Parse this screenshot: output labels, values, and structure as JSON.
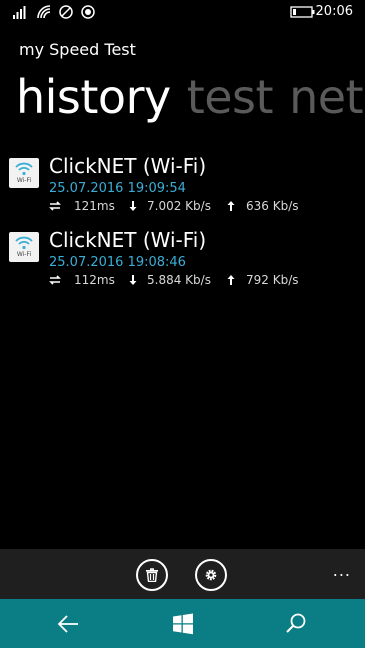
{
  "status": {
    "time": "20:06",
    "icons": [
      "signal-icon",
      "wifi-icon",
      "vibrate-icon",
      "location-icon",
      "battery-icon"
    ]
  },
  "app": {
    "title": "my Speed Test"
  },
  "pivot": {
    "tabs": [
      {
        "label": "history",
        "active": true
      },
      {
        "label": "test",
        "active": false
      },
      {
        "label": "net",
        "active": false
      }
    ]
  },
  "history": [
    {
      "tile_label": "Wi-Fi",
      "name": "ClickNET (Wi-Fi)",
      "date": "25.07.2016 19:09:54",
      "ping": "121ms",
      "download": "7.002 Kb/s",
      "upload": "636 Kb/s"
    },
    {
      "tile_label": "Wi-Fi",
      "name": "ClickNET (Wi-Fi)",
      "date": "25.07.2016 19:08:46",
      "ping": "112ms",
      "download": "5.884 Kb/s",
      "upload": "792 Kb/s"
    }
  ],
  "appbar": {
    "buttons": [
      "delete-icon",
      "settings-icon"
    ],
    "more": "..."
  },
  "navbar": {
    "buttons": [
      "back-icon",
      "windows-icon",
      "search-icon"
    ]
  },
  "colors": {
    "accent": "#3aaed6",
    "nav_bar": "#0b7d84",
    "app_bar": "#1f1f1f"
  }
}
